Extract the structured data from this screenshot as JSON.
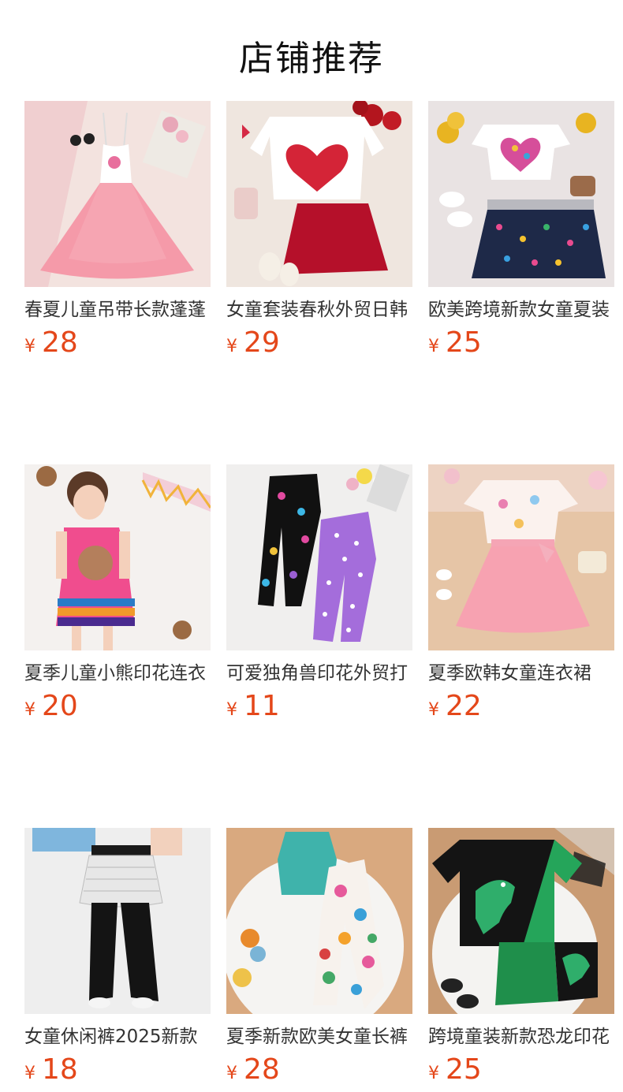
{
  "header": {
    "title": "店铺推荐"
  },
  "currency": "¥",
  "products": [
    {
      "title": "春夏儿童吊带长款蓬蓬",
      "price": "28",
      "image": "pink-tulle-sling-dress"
    },
    {
      "title": "女童套装春秋外贸日韩",
      "price": "29",
      "image": "heart-top-red-skirt-set"
    },
    {
      "title": "欧美跨境新款女童夏装",
      "price": "25",
      "image": "flutter-top-polka-tutu-set"
    },
    {
      "title": "夏季儿童小熊印花连衣",
      "price": "20",
      "image": "girl-bear-print-dress"
    },
    {
      "title": "可爱独角兽印花外贸打",
      "price": "11",
      "image": "unicorn-leggings-pair"
    },
    {
      "title": "夏季欧韩女童连衣裙",
      "price": "22",
      "image": "unicorn-pink-tulle-dress"
    },
    {
      "title": "女童休闲裤2025新款",
      "price": "18",
      "image": "lace-skirt-flare-pants"
    },
    {
      "title": "夏季新款欧美女童长裤",
      "price": "28",
      "image": "teal-tank-floral-pants"
    },
    {
      "title": "跨境童装新款恐龙印花",
      "price": "25",
      "image": "dinosaur-tshirt-shorts-set"
    }
  ]
}
